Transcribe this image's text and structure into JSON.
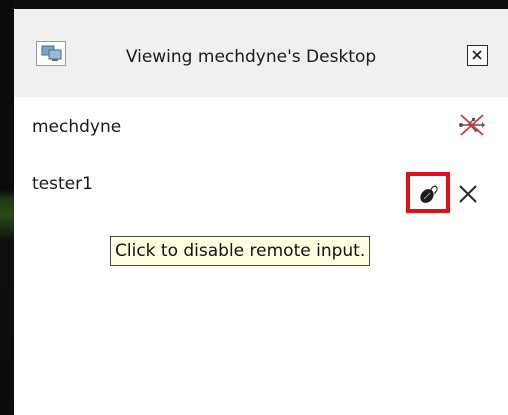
{
  "window": {
    "title": "Viewing mechdyne's Desktop"
  },
  "users": [
    {
      "name": "mechdyne",
      "status_icon": "usb-disconnected-icon"
    },
    {
      "name": "tester1",
      "status_icon": "mouse-remote-input-icon",
      "remove_icon": "close-icon"
    }
  ],
  "tooltip": {
    "text": "Click to disable remote input."
  },
  "colors": {
    "titlebar": "#f0f0f0",
    "highlight": "#e0101a",
    "tooltip_bg": "#ffffe1",
    "usb_cross": "#d9333a"
  }
}
